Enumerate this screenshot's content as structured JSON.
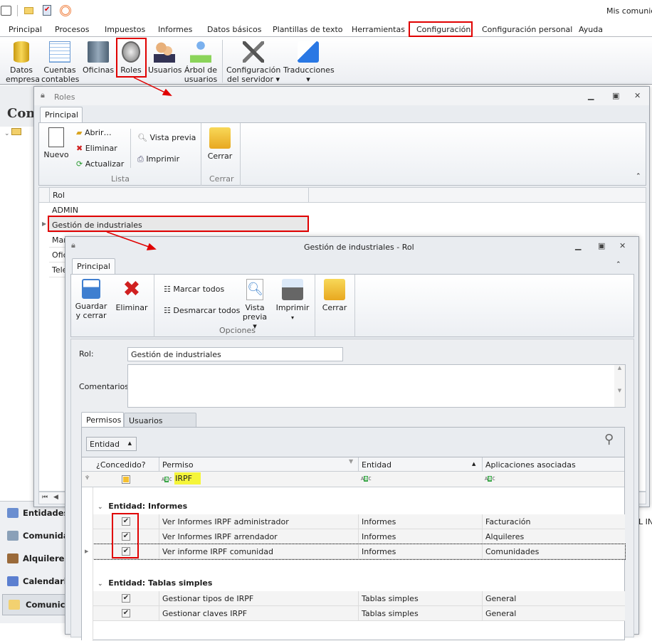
{
  "quick_access": {
    "right_text": "Mis comunicac",
    "icons": [
      "app-icon",
      "mail-icon",
      "tasks-icon",
      "broadcast-icon"
    ]
  },
  "menu": [
    "Principal",
    "Procesos",
    "Impuestos",
    "Informes",
    "Datos básicos",
    "Plantillas de texto",
    "Herramientas",
    "Configuración",
    "Configuración personal",
    "Ayuda"
  ],
  "ribbon": {
    "buttons": [
      {
        "l1": "Datos",
        "l2": "empresa"
      },
      {
        "l1": "Cuentas",
        "l2": "contables"
      },
      {
        "l1": "Oficinas",
        "l2": ""
      },
      {
        "l1": "Roles",
        "l2": ""
      },
      {
        "l1": "Usuarios",
        "l2": ""
      },
      {
        "l1": "Árbol de",
        "l2": "usuarios"
      },
      {
        "l1": "Configuración",
        "l2": "del servidor ▾"
      },
      {
        "l1": "Traducciones",
        "l2": "▾"
      }
    ]
  },
  "background": {
    "heading": "Com",
    "right_text": "L IN"
  },
  "sidebar": [
    "Entidades",
    "Comunidades",
    "Alquileres",
    "Calendario",
    "Comunicaciones"
  ],
  "roles_window": {
    "title": "Roles",
    "tab": "Principal",
    "ribbon": {
      "nuevo": "Nuevo",
      "abrir": "Abrir…",
      "eliminar": "Eliminar",
      "actualizar": "Actualizar",
      "vista_previa": "Vista previa",
      "imprimir": "Imprimir",
      "cerrar": "Cerrar",
      "group_lista": "Lista",
      "group_cerrar": "Cerrar"
    },
    "grid": {
      "header": "Rol",
      "rows": [
        "ADMIN",
        "Gestión de industriales",
        "Mar",
        "Ofic",
        "Tele"
      ]
    }
  },
  "rol_window": {
    "title": "Gestión de industriales - Rol",
    "tab": "Principal",
    "ribbon": {
      "guardar1": "Guardar",
      "guardar2": "y cerrar",
      "eliminar": "Eliminar",
      "marcar": "Marcar todos",
      "desmarcar": "Desmarcar todos",
      "vista1": "Vista",
      "vista2": "previa ▾",
      "imprimir1": "Imprimir",
      "imprimir2": "▾",
      "cerrar": "Cerrar",
      "group_opciones": "Opciones"
    },
    "form": {
      "rol_label": "Rol:",
      "rol_value": "Gestión de industriales",
      "comentarios_label": "Comentarios:",
      "comentarios_value": ""
    },
    "tabs": [
      "Permisos",
      "Usuarios adscritos"
    ],
    "grid": {
      "group_by": "Entidad",
      "columns": [
        "¿Concedido?",
        "Permiso",
        "Entidad",
        "Aplicaciones  asociadas"
      ],
      "filter": {
        "permiso": "IRPF"
      },
      "groups": [
        {
          "label": "Entidad: Informes",
          "rows": [
            {
              "concedido": true,
              "permiso": "Ver Informes IRPF administrador",
              "entidad": "Informes",
              "apps": "Facturación"
            },
            {
              "concedido": true,
              "permiso": "Ver Informes IRPF arrendador",
              "entidad": "Informes",
              "apps": "Alquileres"
            },
            {
              "concedido": true,
              "permiso": "Ver informe IRPF comunidad",
              "entidad": "Informes",
              "apps": "Comunidades"
            }
          ]
        },
        {
          "label": "Entidad: Tablas simples",
          "rows": [
            {
              "concedido": true,
              "permiso": "Gestionar tipos de IRPF",
              "entidad": "Tablas simples",
              "apps": "General"
            },
            {
              "concedido": true,
              "permiso": "Gestionar claves IRPF",
              "entidad": "Tablas simples",
              "apps": "General"
            }
          ]
        }
      ]
    }
  },
  "colors": {
    "highlight": "#e00000",
    "filter_highlight": "#f5f53a"
  }
}
